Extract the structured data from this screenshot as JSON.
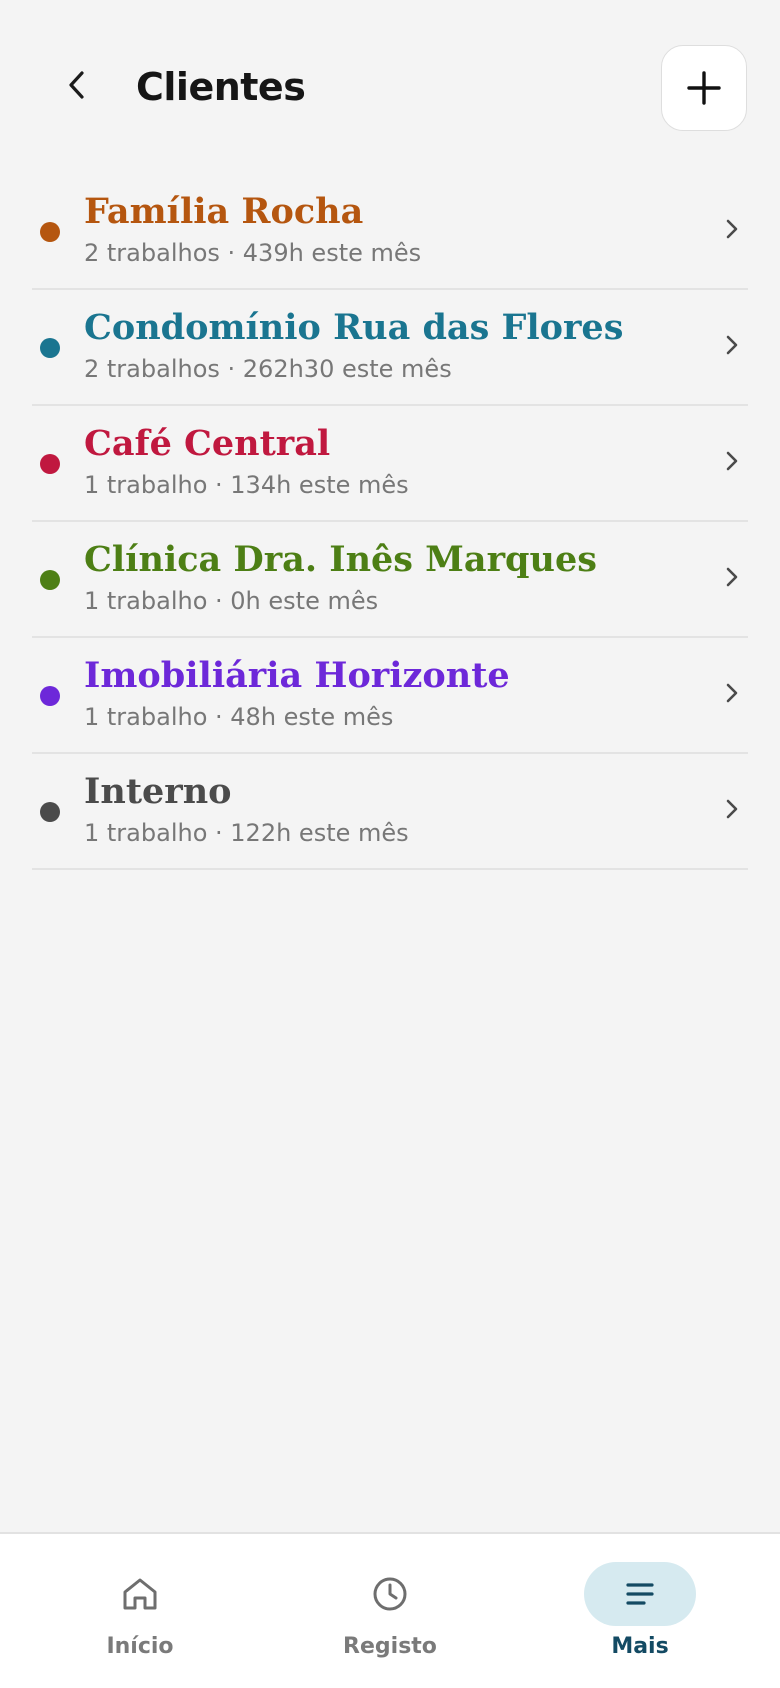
{
  "header": {
    "title": "Clientes",
    "back_icon": "chevron-left-icon",
    "add_icon": "plus-icon"
  },
  "clients": [
    {
      "name": "Família Rocha",
      "jobs": "2 trabalhos",
      "hours": "439h este mês",
      "color": "#b5560f"
    },
    {
      "name": "Condomínio Rua das Flores",
      "jobs": "2 trabalhos",
      "hours": "262h30 este mês",
      "color": "#1a7590"
    },
    {
      "name": "Café Central",
      "jobs": "1 trabalho",
      "hours": "134h este mês",
      "color": "#c0183f"
    },
    {
      "name": "Clínica Dra. Inês Marques",
      "jobs": "1 trabalho",
      "hours": "0h este mês",
      "color": "#4d7f15"
    },
    {
      "name": "Imobiliária Horizonte",
      "jobs": "1 trabalho",
      "hours": "48h este mês",
      "color": "#6d28d9"
    },
    {
      "name": "Interno",
      "jobs": "1 trabalho",
      "hours": "122h este mês",
      "color": "#4b4b4b"
    }
  ],
  "meta_separator": " · ",
  "nav": {
    "items": [
      {
        "label": "Início",
        "icon": "home-icon",
        "active": false
      },
      {
        "label": "Registo",
        "icon": "clock-icon",
        "active": false
      },
      {
        "label": "Mais",
        "icon": "menu-icon",
        "active": true
      }
    ]
  },
  "colors": {
    "background": "#f4f4f4",
    "accent": "#134a63",
    "active_pill": "#d6eaf0",
    "inactive": "#7a7a7a"
  }
}
